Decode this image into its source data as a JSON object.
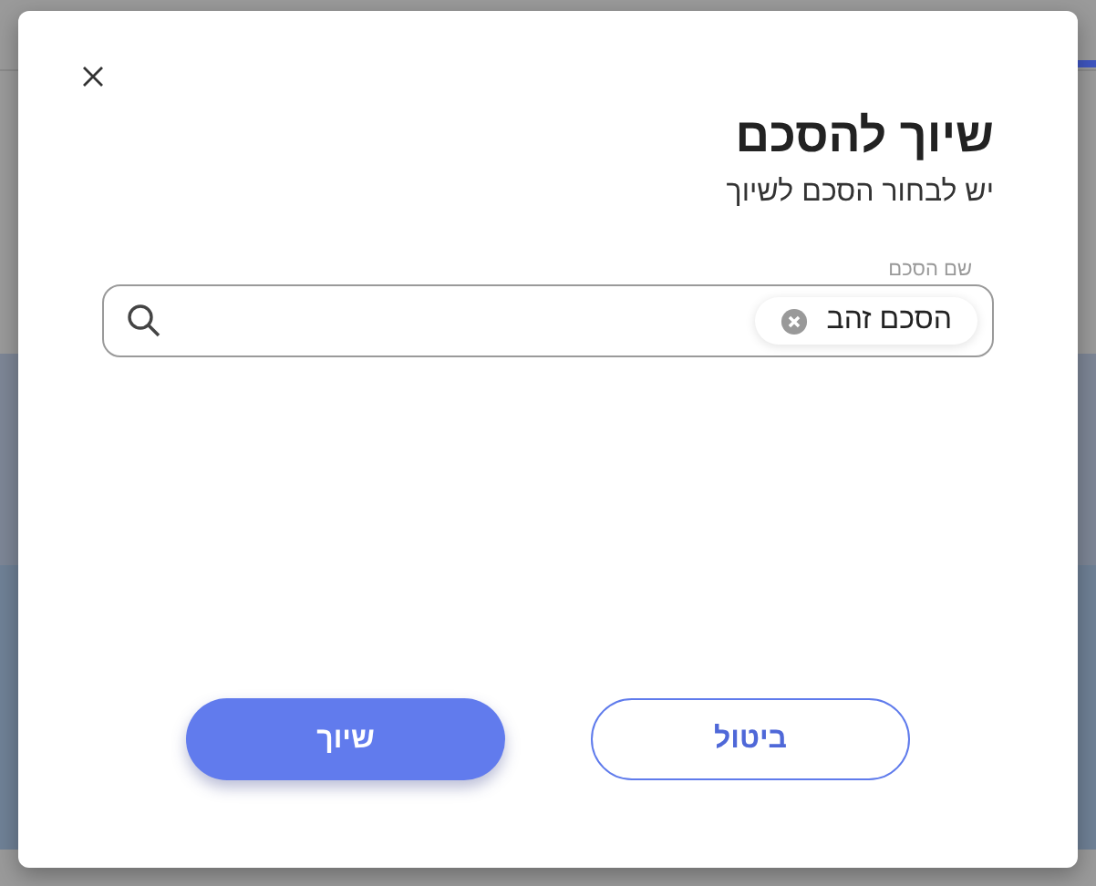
{
  "dialog": {
    "title": "שיוך להסכם",
    "subtitle": "יש לבחור הסכם לשיוך",
    "field": {
      "label": "שם הסכם",
      "chips": [
        {
          "label": "הסכם זהב"
        }
      ]
    },
    "buttons": [
      {
        "label": "ביטול",
        "kind": "secondary"
      },
      {
        "label": "שיוך",
        "kind": "primary"
      }
    ]
  }
}
